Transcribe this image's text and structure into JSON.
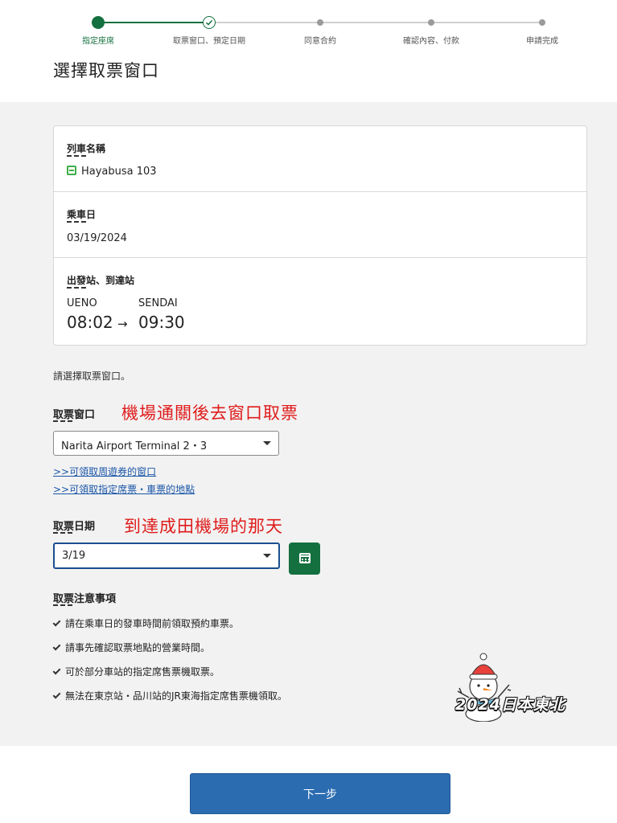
{
  "stepper": {
    "steps": [
      {
        "label": "指定座席",
        "state": "current"
      },
      {
        "label": "取票窗口、預定日期",
        "state": "done"
      },
      {
        "label": "同意合約",
        "state": "pending"
      },
      {
        "label": "確認內容、付款",
        "state": "pending"
      },
      {
        "label": "申請完成",
        "state": "pending"
      }
    ],
    "active_color": "#14703f"
  },
  "page_title": "選擇取票窗口",
  "summary": {
    "train_label": "列車名稱",
    "train_value": "Hayabusa 103",
    "date_label": "乘車日",
    "date_value": "03/19/2024",
    "stations_label": "出發站、到達站",
    "from_station": "UENO",
    "to_station": "SENDAI",
    "depart_time": "08:02",
    "arrow": "→",
    "arrive_time": "09:30"
  },
  "instruction": "請選擇取票窗口。",
  "pickup_window": {
    "label": "取票窗口",
    "note": "機場通關後去窗口取票",
    "selected": "Narita Airport Terminal 2・3"
  },
  "links": {
    "pass_link": ">>可領取周遊券的窗口",
    "ticket_link": ">>可領取指定席票・車票的地點"
  },
  "pickup_date": {
    "label": "取票日期",
    "note": "到達成田機場的那天",
    "selected": "3/19",
    "calendar_icon": "calendar-icon"
  },
  "notes": {
    "title": "取票注意事項",
    "items": [
      "請在乘車日的發車時間前領取預約車票。",
      "請事先確認取票地點的營業時間。",
      "可於部分車站的指定席售票機取票。",
      "無法在東京站・品川站的JR東海指定席售票機領取。"
    ]
  },
  "watermark_text": "2024日本東北",
  "next_button": "下一步",
  "colors": {
    "brand_green": "#14703f",
    "button_blue": "#2b6cb0",
    "link_blue": "#1a56a8",
    "annotation_red": "#e01b1b",
    "panel_gray": "#f2f2f2"
  }
}
